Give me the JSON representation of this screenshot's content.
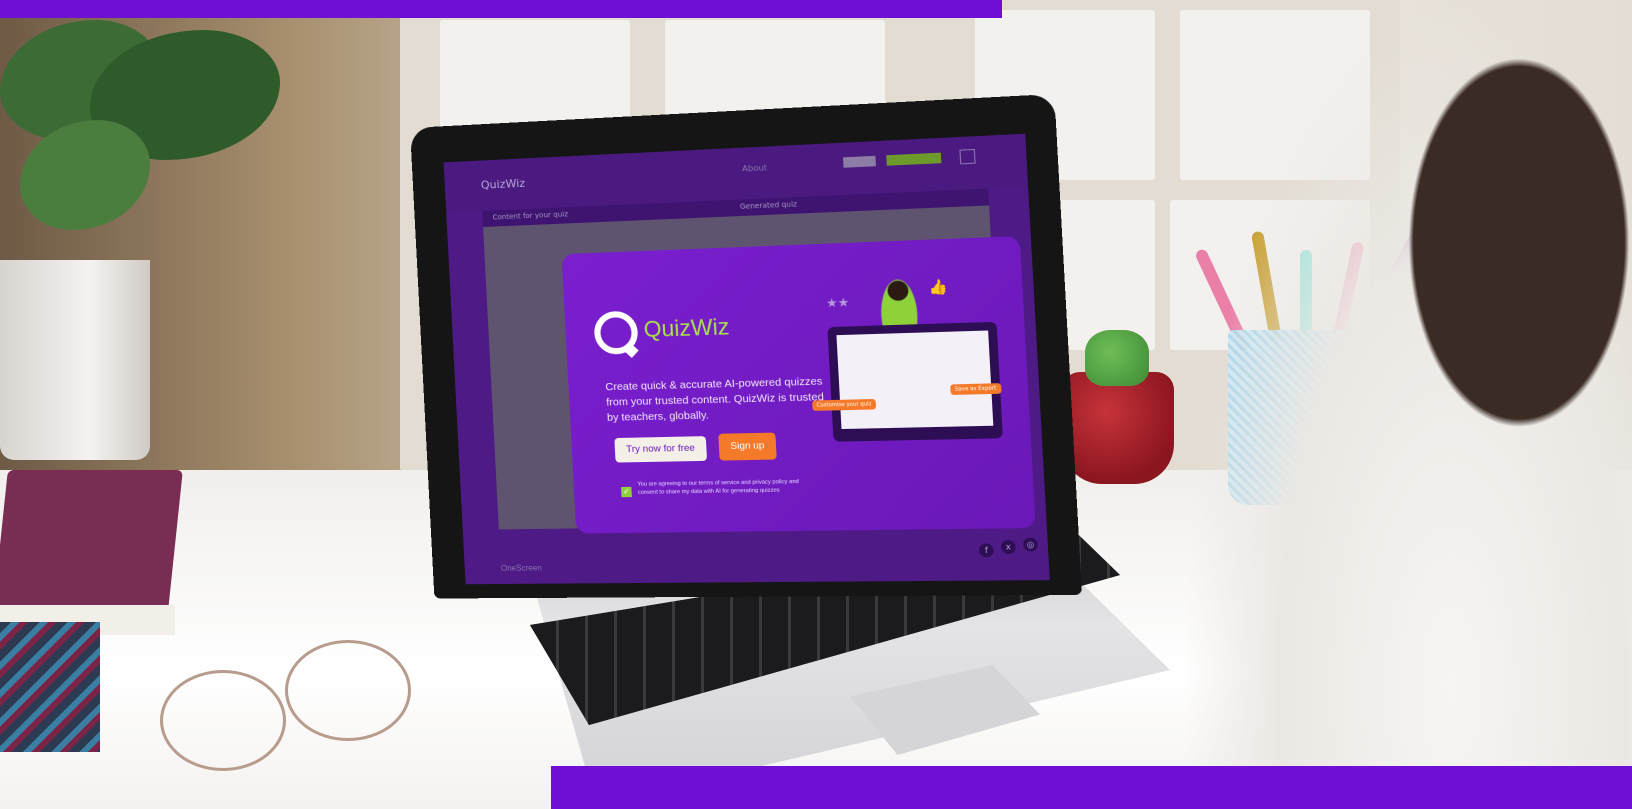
{
  "brand": {
    "name": "QuizWiz",
    "accent": "#6f0fd6",
    "green": "#a8e24a",
    "orange": "#f47a2a"
  },
  "app_bar": {
    "logo_text": "QuizWiz",
    "links": [
      "About"
    ],
    "subbar": {
      "left": "Content for your quiz",
      "center": "Generated quiz"
    }
  },
  "modal": {
    "title": "QuizWiz",
    "description": "Create quick & accurate AI-powered quizzes from your trusted content. QuizWiz is trusted by teachers, globally.",
    "try_button": "Try now for free",
    "signup_button": "Sign up",
    "consent_text": "You are agreeing to our terms of service and privacy policy and consent to share my data with AI for generating quizzes",
    "illustration_tags": [
      "Customise your quiz",
      "Save as Export"
    ]
  },
  "footer": {
    "brand": "OneScreen"
  },
  "social_icons": [
    "facebook-icon",
    "x-icon",
    "instagram-icon"
  ]
}
